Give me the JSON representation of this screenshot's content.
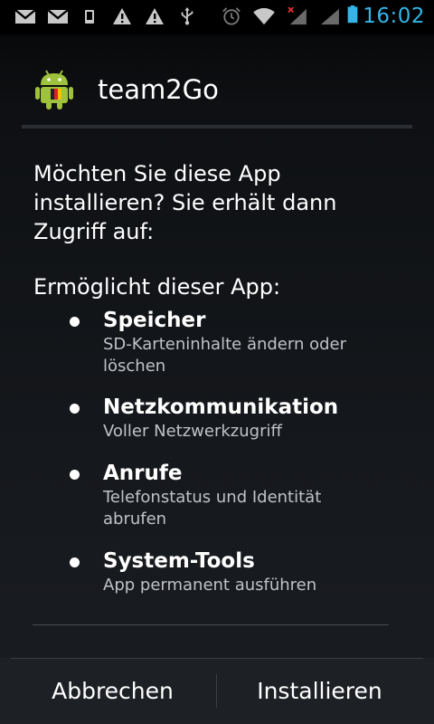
{
  "status_bar": {
    "time": "16:02",
    "icons": [
      "gmail-icon",
      "gmail-icon",
      "device-icon",
      "warning-icon",
      "warning-icon",
      "usb-icon",
      "alarm-icon",
      "wifi-icon",
      "signal-no-data-icon",
      "signal-icon",
      "battery-icon"
    ],
    "accent_color": "#33b5e5"
  },
  "dialog": {
    "app_name": "team2Go",
    "question": "Möchten Sie diese App installieren? Sie erhält dann Zugriff auf:",
    "allows_label": "Ermöglicht dieser App:",
    "permissions": [
      {
        "title": "Speicher",
        "description": "SD-Karteninhalte ändern oder löschen"
      },
      {
        "title": "Netzkommunikation",
        "description": "Voller Netzwerkzugriff"
      },
      {
        "title": "Anrufe",
        "description": "Telefonstatus und Identität abrufen"
      },
      {
        "title": "System-Tools",
        "description": "App permanent ausführen"
      }
    ]
  },
  "buttons": {
    "cancel_label": "Abbrechen",
    "install_label": "Installieren"
  }
}
